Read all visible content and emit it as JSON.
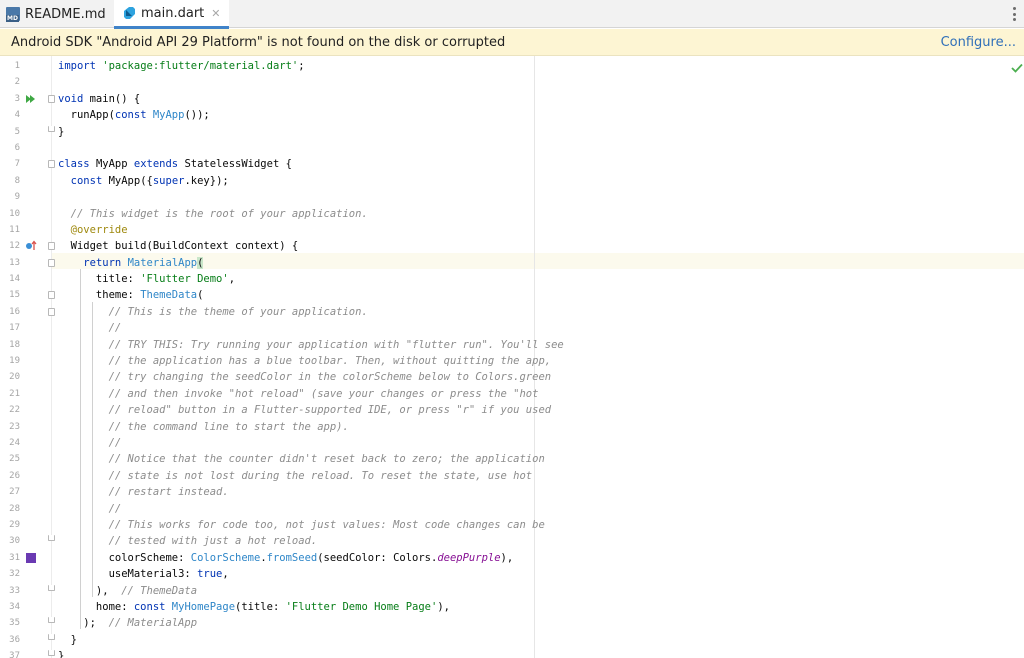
{
  "tabs": [
    {
      "label": "README.md",
      "icon": "markdown-file-icon",
      "active": false
    },
    {
      "label": "main.dart",
      "icon": "dart-file-icon",
      "active": true
    }
  ],
  "banner": {
    "message": "Android SDK \"Android API 29 Platform\" is not found on the disk or corrupted",
    "action": "Configure..."
  },
  "editor": {
    "language": "dart",
    "highlighted_line": 13,
    "lines": [
      {
        "n": "1"
      },
      {
        "n": "2"
      },
      {
        "n": "3"
      },
      {
        "n": "4"
      },
      {
        "n": "5"
      },
      {
        "n": "6"
      },
      {
        "n": "7"
      },
      {
        "n": "8"
      },
      {
        "n": "9"
      },
      {
        "n": "10"
      },
      {
        "n": "11"
      },
      {
        "n": "12"
      },
      {
        "n": "13"
      },
      {
        "n": "14"
      },
      {
        "n": "15"
      },
      {
        "n": "16"
      },
      {
        "n": "17"
      },
      {
        "n": "18"
      },
      {
        "n": "19"
      },
      {
        "n": "20"
      },
      {
        "n": "21"
      },
      {
        "n": "22"
      },
      {
        "n": "23"
      },
      {
        "n": "24"
      },
      {
        "n": "25"
      },
      {
        "n": "26"
      },
      {
        "n": "27"
      },
      {
        "n": "28"
      },
      {
        "n": "29"
      },
      {
        "n": "30"
      },
      {
        "n": "31"
      },
      {
        "n": "32"
      },
      {
        "n": "33"
      },
      {
        "n": "34"
      },
      {
        "n": "35"
      },
      {
        "n": "36"
      },
      {
        "n": "37"
      }
    ],
    "code": {
      "l1": {
        "a": "import ",
        "b": "'package:flutter/material.dart'",
        "c": ";"
      },
      "l3": {
        "a": "void ",
        "b": "main() {"
      },
      "l4": {
        "a": "  runApp(",
        "b": "const ",
        "c": "MyApp",
        "d": "());"
      },
      "l5": {
        "a": "}"
      },
      "l7": {
        "a": "class ",
        "b": "MyApp ",
        "c": "extends ",
        "d": "StatelessWidget {"
      },
      "l8": {
        "a": "  ",
        "b": "const ",
        "c": "MyApp({",
        "d": "super",
        "e": ".key});"
      },
      "l10": {
        "a": "  ",
        "b": "// This widget is the root of your application."
      },
      "l11": {
        "a": "  ",
        "b": "@override"
      },
      "l12": {
        "a": "  Widget build(BuildContext context) {"
      },
      "l13": {
        "a": "    ",
        "b": "return ",
        "c": "MaterialApp",
        "d": "("
      },
      "l14": {
        "a": "      title: ",
        "b": "'Flutter Demo'",
        "c": ","
      },
      "l15": {
        "a": "      theme: ",
        "b": "ThemeData",
        "c": "("
      },
      "l16": {
        "a": "        ",
        "b": "// This is the theme of your application."
      },
      "l17": {
        "a": "        ",
        "b": "//"
      },
      "l18": {
        "a": "        ",
        "b": "// TRY THIS: Try running your application with \"flutter run\". You'll see"
      },
      "l19": {
        "a": "        ",
        "b": "// the application has a blue toolbar. Then, without quitting the app,"
      },
      "l20": {
        "a": "        ",
        "b": "// try changing the seedColor in the colorScheme below to Colors.green"
      },
      "l21": {
        "a": "        ",
        "b": "// and then invoke \"hot reload\" (save your changes or press the \"hot"
      },
      "l22": {
        "a": "        ",
        "b": "// reload\" button in a Flutter-supported IDE, or press \"r\" if you used"
      },
      "l23": {
        "a": "        ",
        "b": "// the command line to start the app)."
      },
      "l24": {
        "a": "        ",
        "b": "//"
      },
      "l25": {
        "a": "        ",
        "b": "// Notice that the counter didn't reset back to zero; the application"
      },
      "l26": {
        "a": "        ",
        "b": "// state is not lost during the reload. To reset the state, use hot"
      },
      "l27": {
        "a": "        ",
        "b": "// restart instead."
      },
      "l28": {
        "a": "        ",
        "b": "//"
      },
      "l29": {
        "a": "        ",
        "b": "// This works for code too, not just values: Most code changes can be"
      },
      "l30": {
        "a": "        ",
        "b": "// tested with just a hot reload."
      },
      "l31": {
        "a": "        colorScheme: ",
        "b": "ColorScheme",
        "c": ".",
        "d": "fromSeed",
        "e": "(seedColor: Colors.",
        "f": "deepPurple",
        "g": "),"
      },
      "l32": {
        "a": "        useMaterial3: ",
        "b": "true",
        "c": ","
      },
      "l33": {
        "a": "      ),  ",
        "b": "// ThemeData"
      },
      "l34": {
        "a": "      home: ",
        "b": "const ",
        "c": "MyHomePage",
        "d": "(title: ",
        "e": "'Flutter Demo Home Page'",
        "f": "),"
      },
      "l35": {
        "a": "    );  ",
        "b": "// MaterialApp"
      },
      "l36": {
        "a": "  }"
      },
      "l37": {
        "a": "}"
      }
    }
  },
  "colors": {
    "keyword": "#0033b3",
    "string": "#067d17",
    "class_ref": "#2e86c8",
    "comment": "#8c8c8c",
    "annotation": "#9e880d",
    "deep_purple_swatch": "#6a3ab2",
    "banner_bg": "#fdf5d3",
    "link": "#2f6fb9"
  }
}
